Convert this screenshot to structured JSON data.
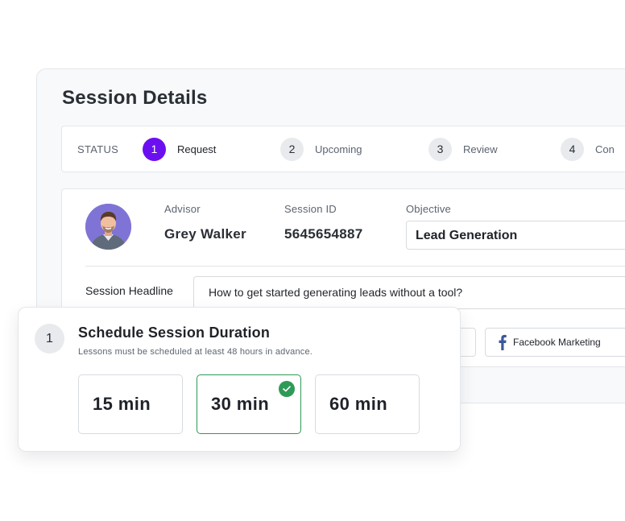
{
  "card": {
    "title": "Session Details",
    "status": {
      "label": "STATUS",
      "steps": [
        {
          "num": "1",
          "label": "Request",
          "active": true
        },
        {
          "num": "2",
          "label": "Upcoming",
          "active": false
        },
        {
          "num": "3",
          "label": "Review",
          "active": false
        },
        {
          "num": "4",
          "label": "Con",
          "active": false
        }
      ]
    },
    "advisor": {
      "label": "Advisor",
      "name": "Grey Walker"
    },
    "session_id": {
      "label": "Session ID",
      "value": "5645654887"
    },
    "objective": {
      "label": "Objective",
      "value": "Lead Generation"
    },
    "headline": {
      "label": "Session Headline",
      "value": "How to get started generating leads without a tool?"
    },
    "tags": [
      {
        "label": "Facebook Marketing",
        "icon": "facebook-icon"
      }
    ]
  },
  "schedule": {
    "step_num": "1",
    "title": "Schedule Session Duration",
    "subtitle": "Lessons must be scheduled at least 48 hours in advance.",
    "options": [
      {
        "label": "15 min",
        "selected": false
      },
      {
        "label": "30 min",
        "selected": true
      },
      {
        "label": "60 min",
        "selected": false
      }
    ]
  },
  "colors": {
    "accent": "#6c0ff0",
    "success": "#2e9a57",
    "facebook": "#3b5998"
  }
}
